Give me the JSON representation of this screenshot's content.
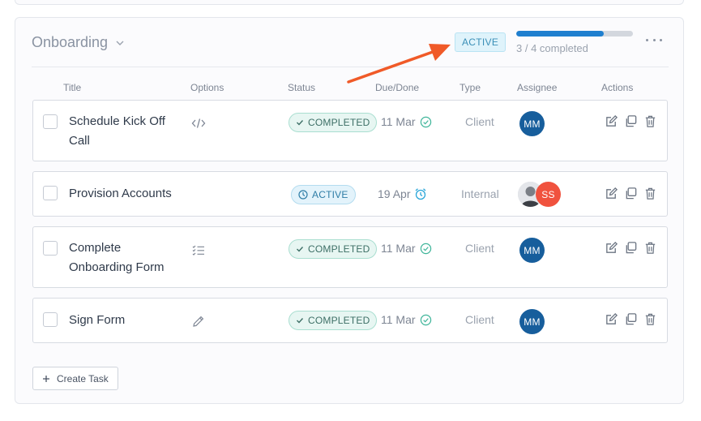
{
  "group": {
    "title": "Onboarding",
    "status_label": "ACTIVE",
    "progress": {
      "completed": 3,
      "total": 4,
      "fraction": 0.75,
      "label": "3 / 4 completed"
    }
  },
  "columns": {
    "title": "Title",
    "options": "Options",
    "status": "Status",
    "due": "Due/Done",
    "type": "Type",
    "assignee": "Assignee",
    "actions": "Actions"
  },
  "tasks": [
    {
      "title_line1": "Schedule Kick Off",
      "title_line2": "Call",
      "option_icon": "code-icon",
      "status": "COMPLETED",
      "date": "11 Mar",
      "date_icon": "check-circle-icon",
      "type": "Client",
      "assignee": "MM"
    },
    {
      "title_line1": "Provision Accounts",
      "title_line2": "",
      "option_icon": "",
      "status": "ACTIVE",
      "date": "19 Apr",
      "date_icon": "alarm-clock-icon",
      "type": "Internal",
      "assignee": "SS"
    },
    {
      "title_line1": "Complete",
      "title_line2": "Onboarding Form",
      "option_icon": "checklist-icon",
      "status": "COMPLETED",
      "date": "11 Mar",
      "date_icon": "check-circle-icon",
      "type": "Client",
      "assignee": "MM"
    },
    {
      "title_line1": "Sign Form",
      "title_line2": "",
      "option_icon": "pencil-icon",
      "status": "COMPLETED",
      "date": "11 Mar",
      "date_icon": "check-circle-icon",
      "type": "Client",
      "assignee": "MM"
    }
  ],
  "create_task_label": "Create Task",
  "colors": {
    "accent_blue": "#1f7fcf",
    "completed_green": "#3d6f66",
    "active_blue": "#2e7da6",
    "avatar_mm": "#175e9c",
    "avatar_ss": "#f0523e",
    "annotation_arrow": "#f05a28"
  }
}
